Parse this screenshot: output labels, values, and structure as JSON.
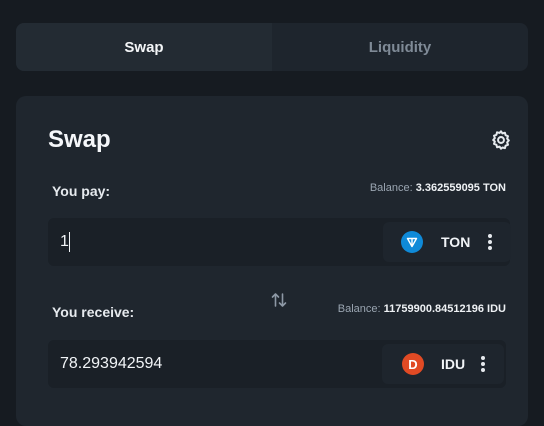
{
  "tabs": [
    {
      "label": "Swap",
      "active": true
    },
    {
      "label": "Liquidity",
      "active": false
    }
  ],
  "card": {
    "title": "Swap",
    "settings_icon": "gear-icon"
  },
  "pay": {
    "label": "You pay:",
    "balance_label": "Balance:",
    "balance_value": "3.362559095 TON",
    "amount": "1",
    "token": {
      "symbol": "TON",
      "icon": "ton-icon",
      "color": "#0f8ad8"
    }
  },
  "switch_icon": "swap-direction-icon",
  "receive": {
    "label": "You receive:",
    "balance_label": "Balance:",
    "balance_value": "11759900.84512196 IDU",
    "amount": "78.293942594",
    "token": {
      "symbol": "IDU",
      "icon": "idu-icon",
      "letter": "D",
      "color": "#e14a24"
    }
  }
}
